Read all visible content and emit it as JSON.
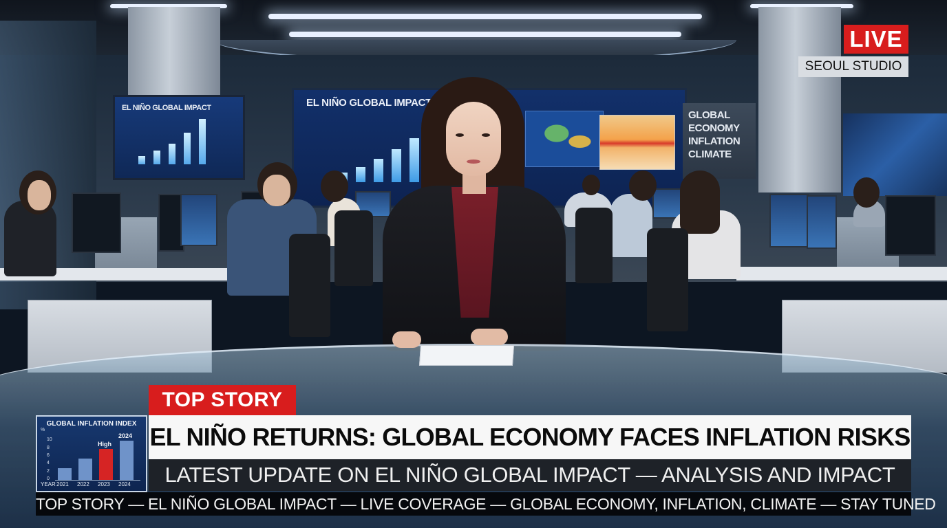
{
  "studio_screens": {
    "main_title": "EL NIÑO GLOBAL IMPACT",
    "side_title": "EL NIÑO GLOBAL IMPACT",
    "words": [
      "GLOBAL",
      "ECONOMY",
      "INFLATION",
      "CLIMATE"
    ]
  },
  "live_badge": "LIVE",
  "studio_label": "SEOUL STUDIO",
  "top_story_tag": "TOP STORY",
  "headline": "EL NIÑO RETURNS: GLOBAL ECONOMY FACES INFLATION RISKS",
  "subline": "LATEST UPDATE ON EL NIÑO GLOBAL IMPACT — ANALYSIS AND IMPACT",
  "ticker": "TOP STORY — EL NIÑO GLOBAL IMPACT — LIVE COVERAGE — GLOBAL ECONOMY, INFLATION, CLIMATE — STAY TUNED",
  "chart_data": {
    "type": "bar",
    "title": "GLOBAL INFLATION INDEX",
    "xlabel": "YEAR",
    "ylabel": "%",
    "categories": [
      "2021",
      "2022",
      "2023",
      "2024"
    ],
    "values": [
      3,
      5.5,
      8,
      10
    ],
    "ylim": [
      0,
      12
    ],
    "yticks": [
      0,
      2,
      4,
      6,
      8,
      10
    ],
    "annotations": [
      {
        "category": "2023",
        "text": "High"
      },
      {
        "category": "2024",
        "text": "2024"
      }
    ],
    "colors": {
      "2021": "#6f93c9",
      "2022": "#6f93c9",
      "2023": "#d62424",
      "2024": "#6f93c9"
    }
  }
}
